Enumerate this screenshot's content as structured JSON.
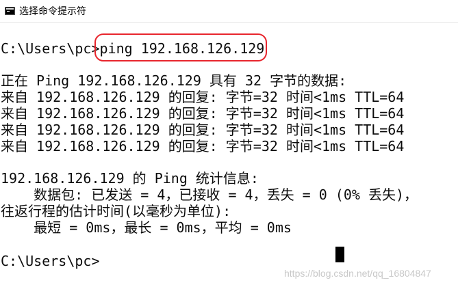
{
  "window": {
    "title": "选择命令提示符",
    "icon": "cmd-console-icon"
  },
  "console": {
    "lines": [
      "C:\\Users\\pc>ping 192.168.126.129",
      "正在 Ping 192.168.126.129 具有 32 字节的数据:",
      "来自 192.168.126.129 的回复: 字节=32 时间<1ms TTL=64",
      "来自 192.168.126.129 的回复: 字节=32 时间<1ms TTL=64",
      "来自 192.168.126.129 的回复: 字节=32 时间<1ms TTL=64",
      "来自 192.168.126.129 的回复: 字节=32 时间<1ms TTL=64",
      "192.168.126.129 的 Ping 统计信息:",
      "    数据包: 已发送 = 4，已接收 = 4，丢失 = 0 (0% 丢失)，",
      "往返行程的估计时间(以毫秒为单位):",
      "    最短 = 0ms，最长 = 0ms，平均 = 0ms",
      "C:\\Users\\pc>"
    ],
    "highlight_color": "#e8242c"
  },
  "watermark": "https://blog.csdn.net/qq_16804847"
}
